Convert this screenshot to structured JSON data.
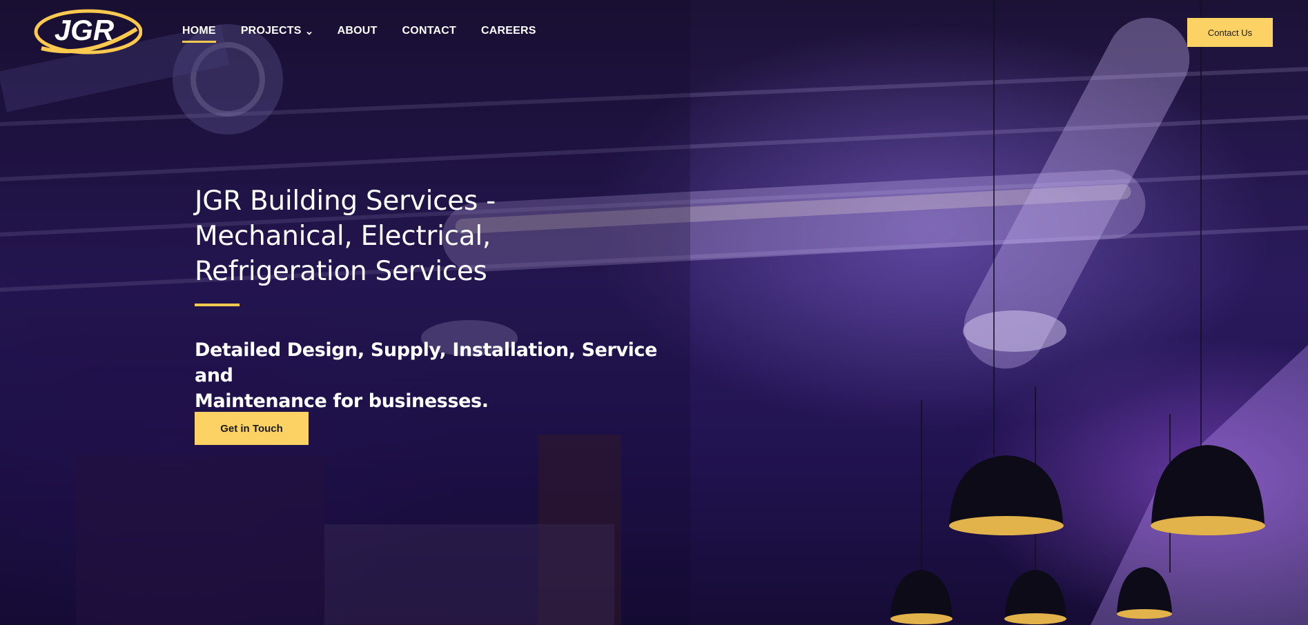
{
  "brand": {
    "logo_text": "JGR",
    "accent_color": "#fdc94e",
    "button_color": "#fdd264"
  },
  "nav": {
    "items": [
      {
        "label": "HOME",
        "active": true
      },
      {
        "label": "PROJECTS",
        "has_dropdown": true
      },
      {
        "label": "ABOUT"
      },
      {
        "label": "CONTACT"
      },
      {
        "label": "CAREERS"
      }
    ]
  },
  "header": {
    "contact_label": "Contact Us"
  },
  "hero": {
    "title_lines": [
      "JGR Building Services -",
      "Mechanical, Electrical,",
      "Refrigeration Services"
    ],
    "subtitle_lines": [
      "Detailed Design, Supply, Installation, Service and",
      "Maintenance for businesses."
    ],
    "cta_label": "Get in Touch"
  },
  "icons": {
    "dropdown": "chevron-down-icon"
  }
}
